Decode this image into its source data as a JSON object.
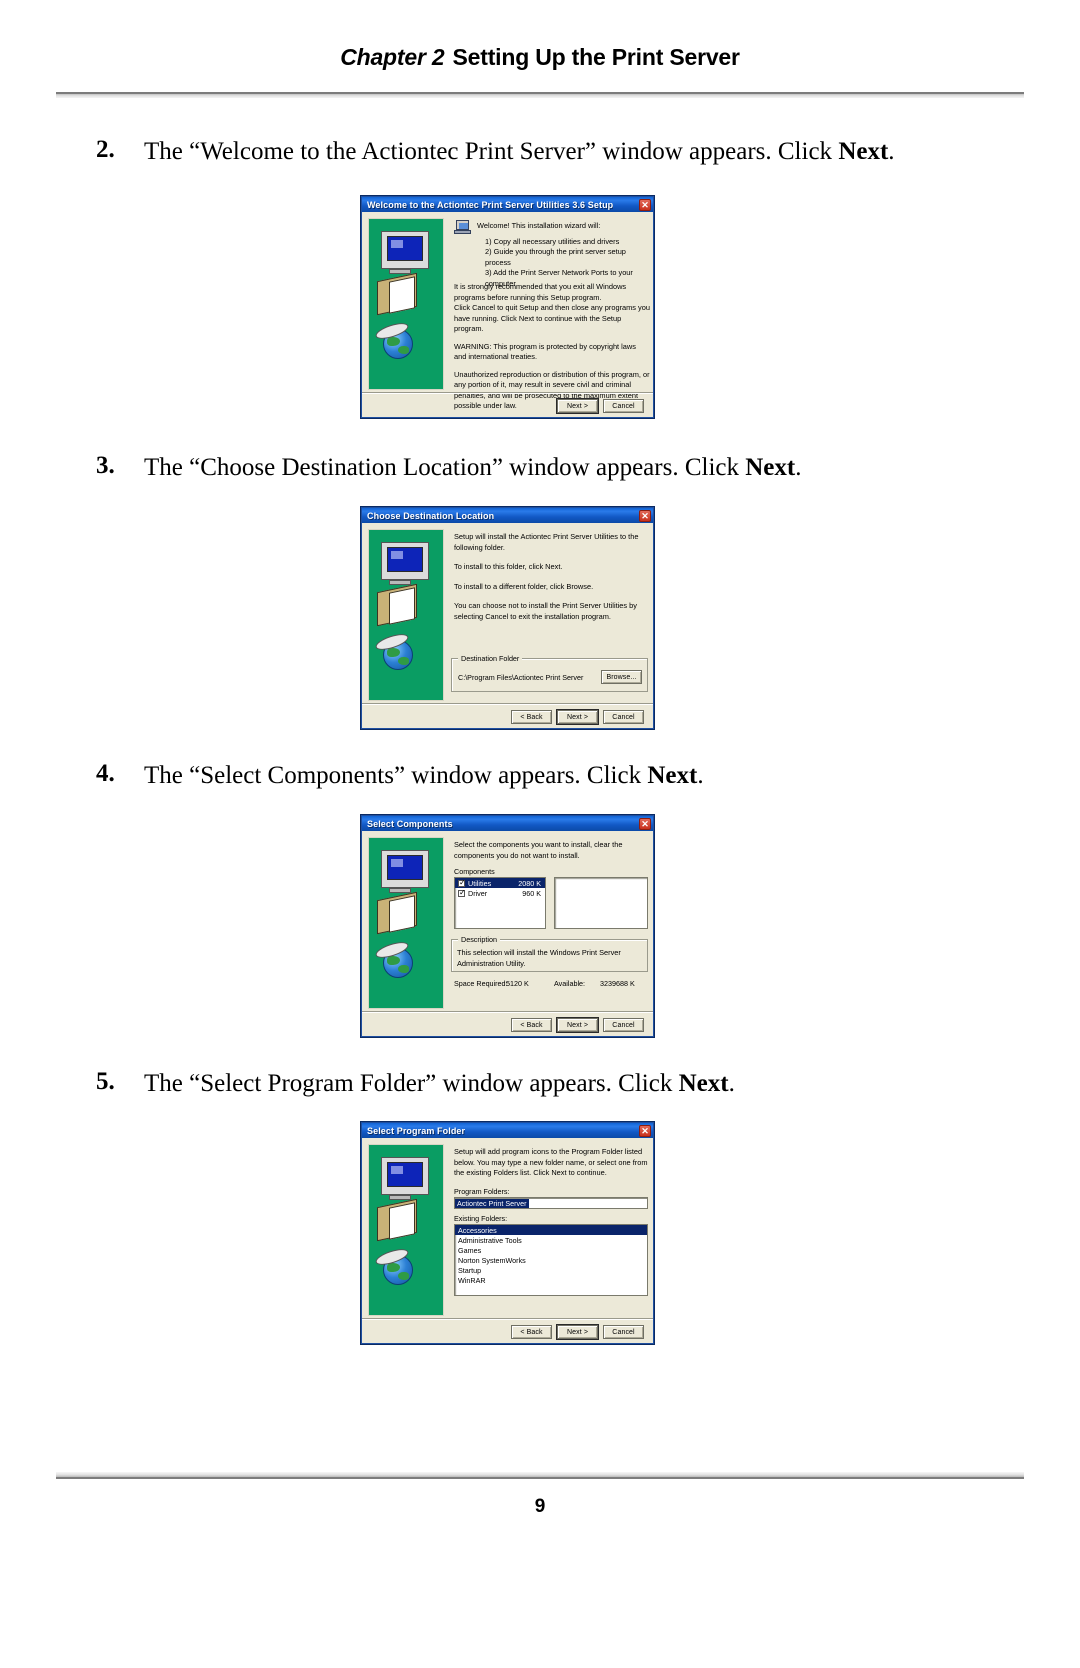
{
  "header": {
    "chapter": "Chapter 2",
    "title": "Setting Up the Print Server"
  },
  "page_number": "9",
  "steps": [
    {
      "num": "2.",
      "text_before": "The “Welcome to the Actiontec Print Server” window appears. Click ",
      "bold": "Next",
      "text_after": "."
    },
    {
      "num": "3.",
      "text_before": "The “Choose Destination Location” window appears. Click ",
      "bold": "Next",
      "text_after": "."
    },
    {
      "num": "4.",
      "text_before": "The “Select Components” window appears. Click ",
      "bold": "Next",
      "text_after": "."
    },
    {
      "num": "5.",
      "text_before": "The “Select Program Folder” window appears. Click ",
      "bold": "Next",
      "text_after": "."
    }
  ],
  "dialog_welcome": {
    "title": "Welcome to the Actiontec Print Server Utilities 3.6 Setup",
    "close_glyph": "✕",
    "intro": "Welcome! This installation wizard will:",
    "bullets": [
      "1) Copy all necessary utilities and drivers",
      "2) Guide you through the print server setup process",
      "3) Add the Print Server Network Ports to your computer"
    ],
    "para1": "It is strongly recommended that you exit all Windows programs before running this Setup program.",
    "para2": "Click Cancel to quit Setup and then close any programs you have running.  Click Next to continue with the Setup program.",
    "para3": "WARNING: This program is protected by copyright laws and international treaties.",
    "para4": "Unauthorized reproduction or distribution of this program, or any portion of it, may result in severe civil and criminal penalties, and will be prosecuted to the maximum extent possible under law.",
    "btn_next": "Next >",
    "btn_cancel": "Cancel"
  },
  "dialog_destination": {
    "title": "Choose Destination Location",
    "close_glyph": "✕",
    "para1": "Setup will install the Actiontec Print Server Utilities to the following folder.",
    "para2": "To install to this folder, click Next.",
    "para3": "To install to a different folder, click Browse.",
    "para4": "You can choose not to install the Print Server Utilities by selecting Cancel to exit the installation program.",
    "group_label": "Destination Folder",
    "path": "C:\\Program Files\\Actiontec Print Server",
    "btn_browse": "Browse...",
    "btn_back": "< Back",
    "btn_next": "Next >",
    "btn_cancel": "Cancel"
  },
  "dialog_components": {
    "title": "Select Components",
    "close_glyph": "✕",
    "para1": "Select the components you want to install, clear the components you do not want to install.",
    "components_label": "Components",
    "components": [
      {
        "name": "Utilities",
        "size": "2080 K",
        "checked": true,
        "selected": true
      },
      {
        "name": "Driver",
        "size": "960 K",
        "checked": true,
        "selected": false
      }
    ],
    "description_label": "Description",
    "description_text": "This selection will install the Windows Print Server Administration Utility.",
    "space_required_label": "Space Required:",
    "space_required_value": "5120 K",
    "available_label": "Available:",
    "available_value": "3239688 K",
    "btn_back": "< Back",
    "btn_next": "Next >",
    "btn_cancel": "Cancel"
  },
  "dialog_program_folder": {
    "title": "Select Program Folder",
    "close_glyph": "✕",
    "para1": "Setup will add program icons to the Program Folder listed below. You may type a new folder name, or select one from the existing Folders list.  Click Next to continue.",
    "program_folders_label": "Program Folders:",
    "program_folder_value": "Actiontec Print Server",
    "existing_folders_label": "Existing Folders:",
    "existing_folders": [
      {
        "name": "Accessories",
        "selected": true
      },
      {
        "name": "Administrative Tools",
        "selected": false
      },
      {
        "name": "Games",
        "selected": false
      },
      {
        "name": "Norton SystemWorks",
        "selected": false
      },
      {
        "name": "Startup",
        "selected": false
      },
      {
        "name": "WinRAR",
        "selected": false
      }
    ],
    "btn_back": "< Back",
    "btn_next": "Next >",
    "btn_cancel": "Cancel"
  }
}
